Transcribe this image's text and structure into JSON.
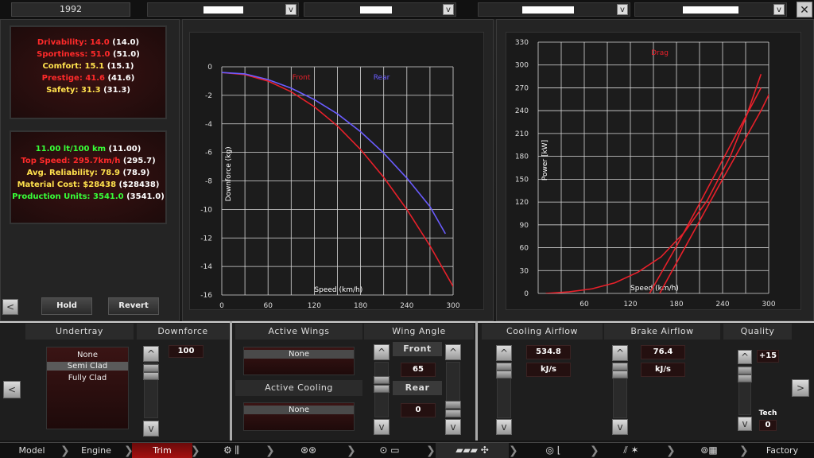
{
  "year": "1992",
  "close_label": "✕",
  "dropdown_arrow": "v",
  "stats1": [
    {
      "label": "Drivability:",
      "value": "14.0",
      "paren": "(14.0)",
      "color": "red"
    },
    {
      "label": "Sportiness:",
      "value": "51.0",
      "paren": "(51.0)",
      "color": "red"
    },
    {
      "label": "Comfort:",
      "value": "15.1",
      "paren": "(15.1)",
      "color": "yel"
    },
    {
      "label": "Prestige:",
      "value": "41.6",
      "paren": "(41.6)",
      "color": "red"
    },
    {
      "label": "Safety:",
      "value": "31.3",
      "paren": "(31.3)",
      "color": "yel"
    }
  ],
  "stats2": [
    {
      "label": "11.00 lt/100 km",
      "paren": "(11.00)",
      "color": "grn"
    },
    {
      "label": "Top Speed: 295.7km/h",
      "paren": "(295.7)",
      "color": "red"
    },
    {
      "label": "Avg. Reliability: 78.9",
      "paren": "(78.9)",
      "color": "yel"
    },
    {
      "label": "Material Cost: $28438",
      "paren": "($28438)",
      "color": "yel"
    },
    {
      "label": "Production Units: 3541.0",
      "paren": "(3541.0)",
      "color": "grn"
    }
  ],
  "buttons": {
    "hold": "Hold",
    "revert": "Revert",
    "left": "<",
    "right": ">",
    "up": "^",
    "down": "v"
  },
  "chart_data": [
    {
      "type": "line",
      "xlabel": "Speed (km/h)",
      "ylabel": "Downforce (kg)",
      "xlim": [
        0,
        300
      ],
      "ylim": [
        -16,
        0
      ],
      "xticks": [
        0,
        60,
        120,
        180,
        240,
        300
      ],
      "yticks": [
        0,
        -2,
        -4,
        -6,
        -8,
        -10,
        -12,
        -14,
        -16
      ],
      "grid": true,
      "legend": "top",
      "series": [
        {
          "name": "Front",
          "color": "#e8202a",
          "x": [
            0,
            30,
            60,
            90,
            120,
            150,
            180,
            210,
            240,
            270,
            300
          ],
          "y": [
            -0.4,
            -0.55,
            -1.0,
            -1.75,
            -2.8,
            -4.15,
            -5.8,
            -7.75,
            -10.0,
            -12.55,
            -15.4
          ]
        },
        {
          "name": "Rear",
          "color": "#6a5cff",
          "x": [
            0,
            30,
            60,
            90,
            120,
            150,
            180,
            210,
            240,
            270,
            290
          ],
          "y": [
            -0.4,
            -0.5,
            -0.9,
            -1.5,
            -2.3,
            -3.3,
            -4.55,
            -6.05,
            -7.8,
            -9.8,
            -11.7
          ]
        }
      ]
    },
    {
      "type": "line",
      "xlabel": "Speed (km/h)",
      "ylabel": "Power [kW]",
      "xlim": [
        0,
        300
      ],
      "ylim": [
        0,
        330
      ],
      "xticks": [
        60,
        120,
        180,
        240,
        300
      ],
      "yticks": [
        0,
        30,
        60,
        90,
        120,
        150,
        180,
        210,
        240,
        270,
        300,
        330
      ],
      "grid": true,
      "legend": "top",
      "series": [
        {
          "name": "Drag",
          "color": "#e8202a",
          "x": [
            10,
            40,
            70,
            100,
            130,
            160,
            190,
            220,
            250,
            270,
            290
          ],
          "y": [
            0,
            2,
            6,
            14,
            28,
            48,
            80,
            122,
            180,
            230,
            288
          ]
        },
        {
          "name": "",
          "color": "#e8202a",
          "x": [
            145,
            180,
            210,
            240,
            270,
            290
          ],
          "y": [
            0,
            62,
            118,
            175,
            232,
            270
          ]
        },
        {
          "name": "",
          "color": "#e8202a",
          "x": [
            120,
            180,
            240,
            290,
            334
          ],
          "y": [
            -70,
            40,
            150,
            240,
            330
          ]
        }
      ]
    }
  ],
  "bottom": {
    "undertray_header": "Undertray",
    "undertray_options": [
      "None",
      "Semi Clad",
      "Fully Clad"
    ],
    "downforce_header": "Downforce",
    "downforce_value": "100",
    "active_wings_header": "Active Wings",
    "active_wings_value": "None",
    "active_cooling_header": "Active Cooling",
    "active_cooling_value": "None",
    "wing_angle_header": "Wing Angle",
    "front_label": "Front",
    "front_value": "65",
    "rear_label": "Rear",
    "rear_value": "0",
    "cooling_header": "Cooling Airflow",
    "cooling_value": "534.8",
    "cooling_unit": "kJ/s",
    "brake_header": "Brake Airflow",
    "brake_value": "76.4",
    "brake_unit": "kJ/s",
    "quality_header": "Quality",
    "quality_value": "+15",
    "tech_label": "Tech",
    "tech_value": "0"
  },
  "nav": {
    "model": "Model",
    "engine": "Engine",
    "trim": "Trim",
    "chassis_icon": "⚙ ⫼",
    "wheels_icon": "⊛⊛",
    "body_icon": "⊙ ▭",
    "car_icon": "▰▰▰ ✣",
    "interior_icon": "◎ ⌊",
    "test_icon": "⫽ ✶",
    "finish_icon": "⊚▦",
    "factory": "Factory",
    "chev": "❯"
  }
}
